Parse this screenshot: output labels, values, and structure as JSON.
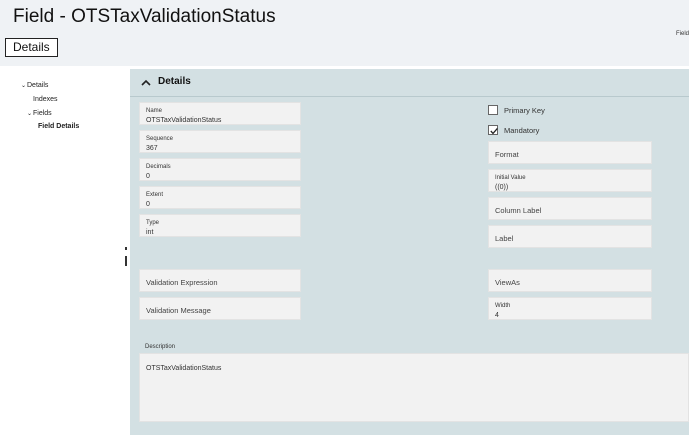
{
  "header": {
    "title": "Field - OTSTaxValidationStatus",
    "tab_label": "Details",
    "corner_label": "Field"
  },
  "tree": {
    "items": [
      {
        "label": "Details",
        "expanded": true
      },
      {
        "label": "Indexes"
      },
      {
        "label": "Fields",
        "expanded": true
      },
      {
        "label": "Field Details",
        "selected": true
      }
    ]
  },
  "section": {
    "title": "Details"
  },
  "fields": {
    "name": {
      "label": "Name",
      "value": "OTSTaxValidationStatus"
    },
    "sequence": {
      "label": "Sequence",
      "value": "367"
    },
    "decimals": {
      "label": "Decimals",
      "value": "0"
    },
    "extent": {
      "label": "Extent",
      "value": "0"
    },
    "type": {
      "label": "Type",
      "value": "int"
    },
    "validation_expression": {
      "label": "Validation Expression"
    },
    "validation_message": {
      "label": "Validation Message"
    },
    "primary_key": {
      "label": "Primary Key",
      "checked": false
    },
    "mandatory": {
      "label": "Mandatory",
      "checked": true
    },
    "format": {
      "label": "Format"
    },
    "initial_value": {
      "label": "Initial Value",
      "value": "((0))"
    },
    "column_label": {
      "label": "Column Label"
    },
    "label": {
      "label": "Label"
    },
    "view_as": {
      "label": "ViewAs"
    },
    "width": {
      "label": "Width",
      "value": "4"
    },
    "description": {
      "label": "Description",
      "value": "OTSTaxValidationStatus"
    }
  },
  "colors": {
    "header_bg": "#eff2f5",
    "panel_bg": "#d3e0e3",
    "field_bg": "#f2f2f2"
  }
}
